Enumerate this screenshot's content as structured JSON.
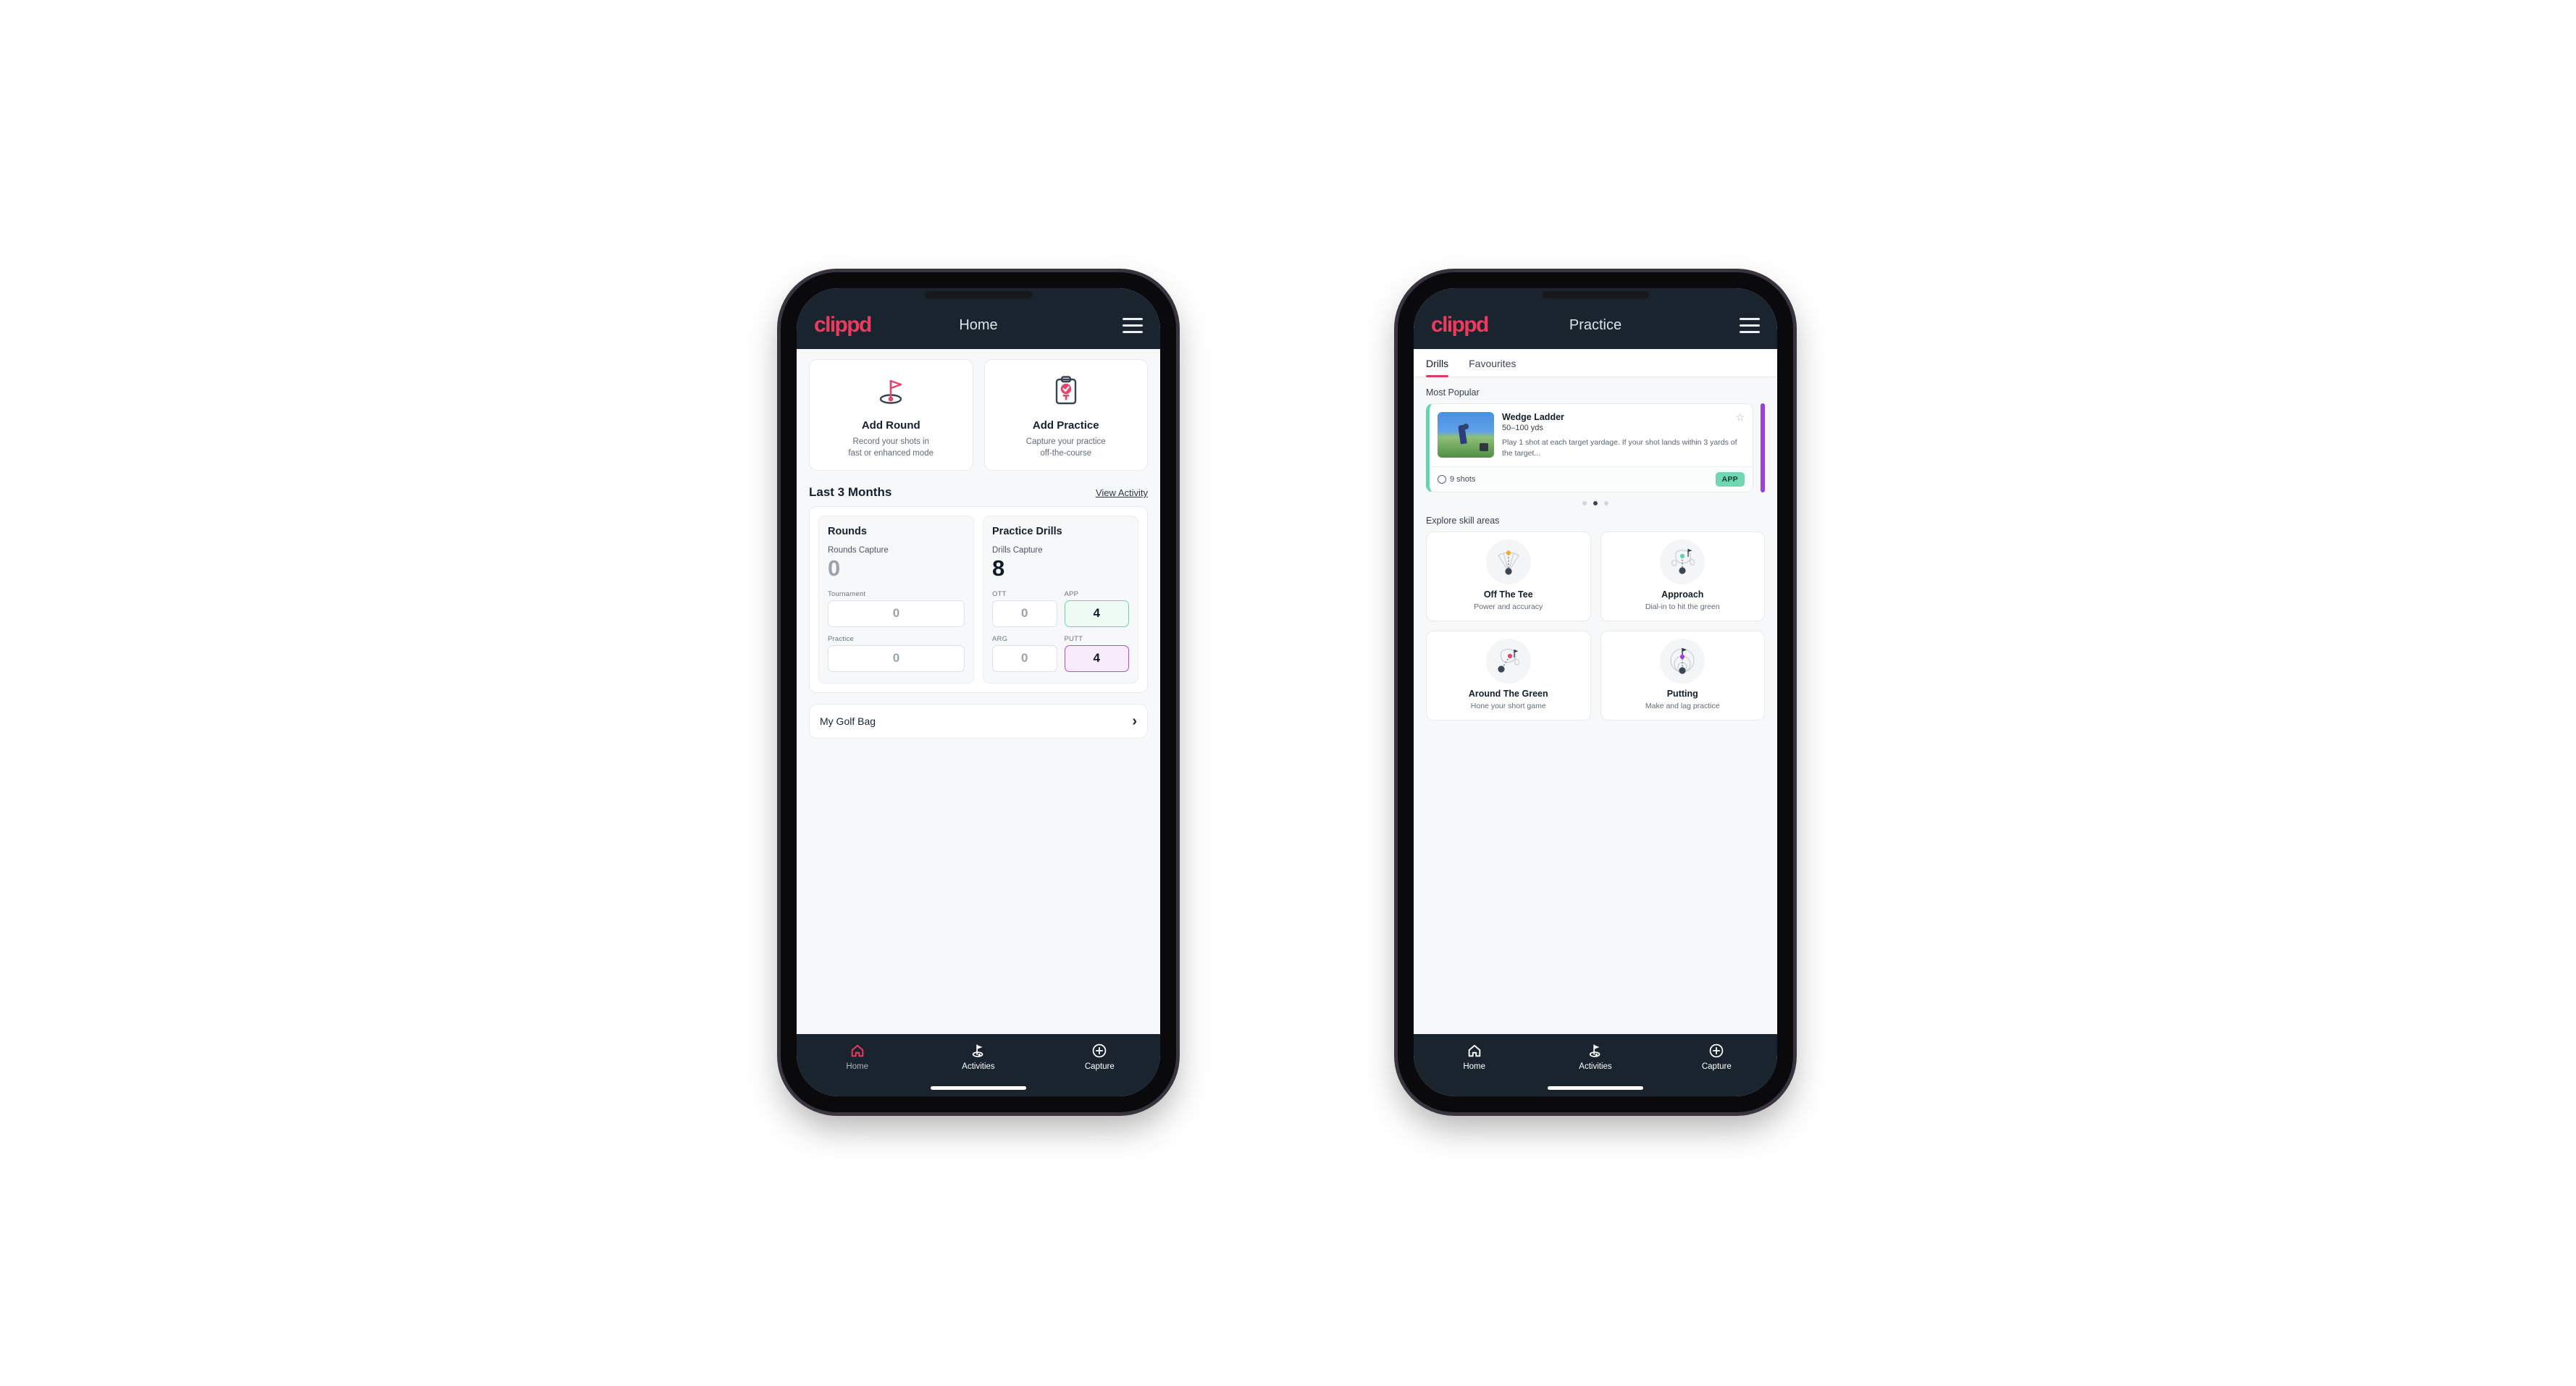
{
  "phone_home": {
    "appbar": {
      "logo": "clippd",
      "title": "Home",
      "menu_icon": "hamburger-icon"
    },
    "actions": [
      {
        "icon": "golf-flag-hole-icon",
        "title": "Add Round",
        "sub_line1": "Record your shots in",
        "sub_line2": "fast or enhanced mode"
      },
      {
        "icon": "clipboard-check-tee-icon",
        "title": "Add Practice",
        "sub_line1": "Capture your practice",
        "sub_line2": "off-the-course"
      }
    ],
    "section": {
      "title": "Last 3 Months",
      "link": "View Activity"
    },
    "rounds": {
      "heading": "Rounds",
      "capture_label": "Rounds Capture",
      "capture_value": "0",
      "rows": [
        {
          "label": "Tournament",
          "value": "0"
        },
        {
          "label": "Practice",
          "value": "0"
        }
      ]
    },
    "drills": {
      "heading": "Practice Drills",
      "capture_label": "Drills Capture",
      "capture_value": "8",
      "cells": [
        {
          "label": "OTT",
          "value": "0",
          "state": "plain"
        },
        {
          "label": "APP",
          "value": "4",
          "state": "app"
        },
        {
          "label": "ARG",
          "value": "0",
          "state": "plain"
        },
        {
          "label": "PUTT",
          "value": "4",
          "state": "putt"
        }
      ]
    },
    "golf_bag": {
      "label": "My Golf Bag",
      "chevron": "chevron-right-icon"
    },
    "bottom_nav": [
      {
        "icon": "home-icon",
        "label": "Home",
        "active": true
      },
      {
        "icon": "golf-flag-icon",
        "label": "Activities",
        "active": false
      },
      {
        "icon": "plus-circle-icon",
        "label": "Capture",
        "active": false
      }
    ]
  },
  "phone_practice": {
    "appbar": {
      "logo": "clippd",
      "title": "Practice",
      "menu_icon": "hamburger-icon"
    },
    "tabs": [
      {
        "label": "Drills",
        "active": true
      },
      {
        "label": "Favourites",
        "active": false
      }
    ],
    "most_popular_label": "Most Popular",
    "drill": {
      "title": "Wedge Ladder",
      "yardage": "50–100 yds",
      "description": "Play 1 shot at each target yardage. If your shot lands within 3 yards of the target...",
      "shots": "9 shots",
      "badge": "APP",
      "star_icon": "star-outline-icon",
      "shots_icon": "golf-ball-icon",
      "accent_color": "#64d6ab",
      "next_accent_color": "#a13ce0"
    },
    "carousel_dots": {
      "count": 3,
      "active_index": 1
    },
    "skill_header": "Explore skill areas",
    "skills": [
      {
        "icon": "tee-shot-fan-icon",
        "title": "Off The Tee",
        "sub": "Power and accuracy",
        "dot_color": "#f0a92b"
      },
      {
        "icon": "green-approach-icon",
        "title": "Approach",
        "sub": "Dial-in to hit the green",
        "dot_color": "#5fd2ac"
      },
      {
        "icon": "chip-around-green-icon",
        "title": "Around The Green",
        "sub": "Hone your short game",
        "dot_color": "#e8456a"
      },
      {
        "icon": "putting-rings-icon",
        "title": "Putting",
        "sub": "Make and lag practice",
        "dot_color": "#a13ce0"
      }
    ],
    "bottom_nav": [
      {
        "icon": "home-icon",
        "label": "Home",
        "active": false
      },
      {
        "icon": "golf-flag-icon",
        "label": "Activities",
        "active": false
      },
      {
        "icon": "plus-circle-icon",
        "label": "Capture",
        "active": false
      }
    ]
  },
  "colors": {
    "brand_pink": "#ee3a5c",
    "navy": "#19242f",
    "app_teal": "#6ed4ae",
    "putt_purple": "#b44ddb",
    "page_bg": "#f7f8f9"
  }
}
